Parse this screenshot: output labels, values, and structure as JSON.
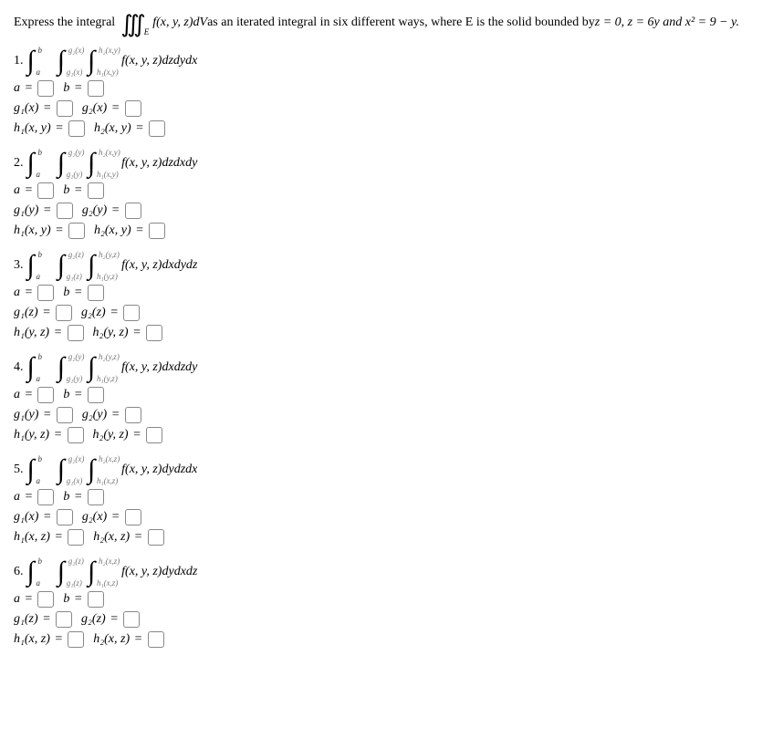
{
  "problem": {
    "lead": "Express the integral",
    "integrand_top": "f(x, y, z)dV",
    "mid": " as an iterated integral in six different ways, where E is the solid bounded by ",
    "constraints": "z = 0, z = 6y and x² = 9 − y."
  },
  "parts": [
    {
      "num": "1.",
      "int1": {
        "lo": "a",
        "hi": "b"
      },
      "int2": {
        "lo": "g₁(x)",
        "hi": "g₂(x)"
      },
      "int3": {
        "lo": "h₁(x,y)",
        "hi": "h₂(x,y)"
      },
      "integrand": "f(x, y, z)dzdydx",
      "rows": [
        [
          "a =",
          "",
          "b =",
          ""
        ],
        [
          "g₁(x) =",
          "",
          "g₂(x) =",
          ""
        ],
        [
          "h₁(x, y) =",
          "",
          "h₂(x, y) =",
          ""
        ]
      ]
    },
    {
      "num": "2.",
      "int1": {
        "lo": "a",
        "hi": "b"
      },
      "int2": {
        "lo": "g₁(y)",
        "hi": "g₂(y)"
      },
      "int3": {
        "lo": "h₁(x,y)",
        "hi": "h₂(x,y)"
      },
      "integrand": "f(x, y, z)dzdxdy",
      "rows": [
        [
          "a =",
          "",
          "b =",
          ""
        ],
        [
          "g₁(y) =",
          "",
          "g₂(y) =",
          ""
        ],
        [
          "h₁(x, y) =",
          "",
          "h₂(x, y) =",
          ""
        ]
      ]
    },
    {
      "num": "3.",
      "int1": {
        "lo": "a",
        "hi": "b"
      },
      "int2": {
        "lo": "g₁(z)",
        "hi": "g₂(z)"
      },
      "int3": {
        "lo": "h₁(y,z)",
        "hi": "h₂(y,z)"
      },
      "integrand": "f(x, y, z)dxdydz",
      "rows": [
        [
          "a =",
          "",
          "b =",
          ""
        ],
        [
          "g₁(z) =",
          "",
          "g₂(z) =",
          ""
        ],
        [
          "h₁(y, z) =",
          "",
          "h₂(y, z) =",
          ""
        ]
      ]
    },
    {
      "num": "4.",
      "int1": {
        "lo": "a",
        "hi": "b"
      },
      "int2": {
        "lo": "g₁(y)",
        "hi": "g₂(y)"
      },
      "int3": {
        "lo": "h₁(y,z)",
        "hi": "h₂(y,z)"
      },
      "integrand": "f(x, y, z)dxdzdy",
      "rows": [
        [
          "a =",
          "",
          "b =",
          ""
        ],
        [
          "g₁(y) =",
          "",
          "g₂(y) =",
          ""
        ],
        [
          "h₁(y, z) =",
          "",
          "h₂(y, z) =",
          ""
        ]
      ]
    },
    {
      "num": "5.",
      "int1": {
        "lo": "a",
        "hi": "b"
      },
      "int2": {
        "lo": "g₁(x)",
        "hi": "g₂(x)"
      },
      "int3": {
        "lo": "h₁(x,z)",
        "hi": "h₂(x,z)"
      },
      "integrand": "f(x, y, z)dydzdx",
      "rows": [
        [
          "a =",
          "",
          "b =",
          ""
        ],
        [
          "g₁(x) =",
          "",
          "g₂(x) =",
          ""
        ],
        [
          "h₁(x, z) =",
          "",
          "h₂(x, z) =",
          ""
        ]
      ]
    },
    {
      "num": "6.",
      "int1": {
        "lo": "a",
        "hi": "b"
      },
      "int2": {
        "lo": "g₁(z)",
        "hi": "g₂(z)"
      },
      "int3": {
        "lo": "h₁(x,z)",
        "hi": "h₂(x,z)"
      },
      "integrand": "f(x, y, z)dydxdz",
      "rows": [
        [
          "a =",
          "",
          "b =",
          ""
        ],
        [
          "g₁(z) =",
          "",
          "g₂(z) =",
          ""
        ],
        [
          "h₁(x, z) =",
          "",
          "h₂(x, z) =",
          ""
        ]
      ]
    }
  ]
}
